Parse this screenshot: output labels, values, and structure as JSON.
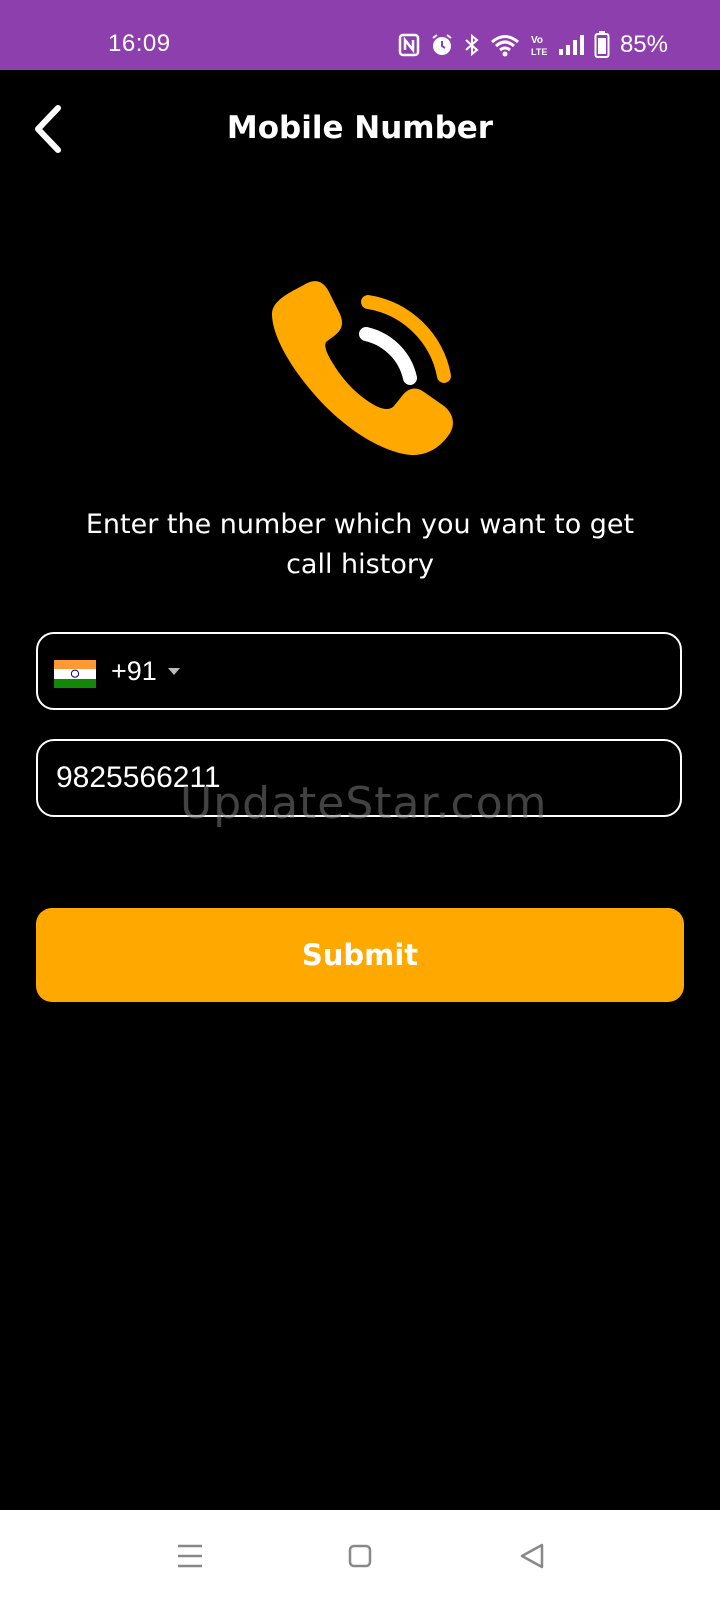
{
  "status_bar": {
    "time": "16:09",
    "battery_percent": "85%",
    "icons": [
      "nfc-icon",
      "alarm-icon",
      "bluetooth-icon",
      "wifi-icon",
      "volte-icon",
      "signal-icon",
      "battery-icon"
    ],
    "background_color": "#8e3fae"
  },
  "app_bar": {
    "title": "Mobile Number",
    "back_icon": "chevron-left-icon"
  },
  "hero": {
    "icon": "phone-call-icon",
    "color": "#ffa800"
  },
  "instruction": "Enter the number which you want to get call history",
  "country_picker": {
    "flag": "india-flag-icon",
    "code": "+91",
    "arrow_icon": "dropdown-arrow-icon"
  },
  "phone_field": {
    "value": "9825566211"
  },
  "watermark": "UpdateStar.com",
  "submit": {
    "label": "Submit",
    "color": "#ffa800"
  },
  "nav_bar": {
    "items": [
      "menu-icon",
      "home-icon",
      "back-icon"
    ]
  }
}
